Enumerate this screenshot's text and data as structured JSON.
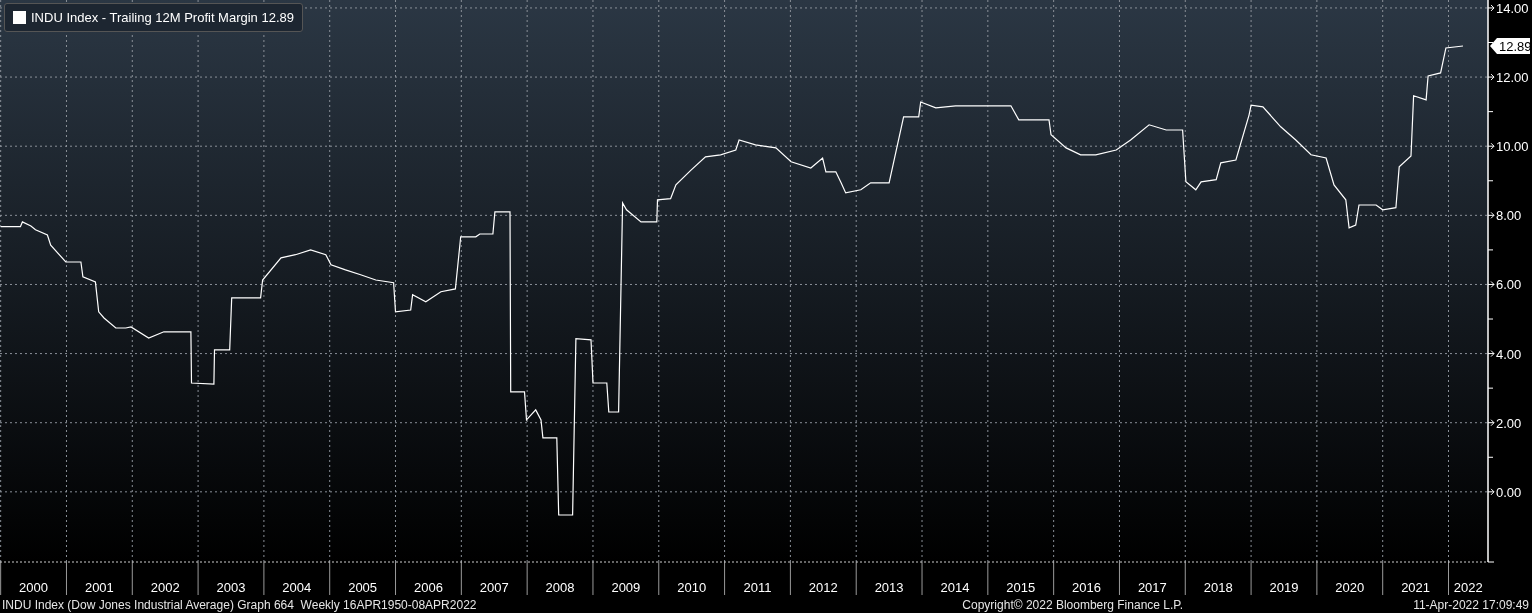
{
  "chart": {
    "legend": {
      "value": "12.89"
    },
    "last_value_tag": "12.89",
    "chart_data": {
      "type": "line",
      "grid": true,
      "xlim": [
        1999.99,
        2022.6
      ],
      "ylim": [
        -2.03,
        14.23
      ],
      "yticks": [
        {
          "value": 0,
          "label": "0.00"
        },
        {
          "value": 2,
          "label": "2.00"
        },
        {
          "value": 4,
          "label": "4.00"
        },
        {
          "value": 6,
          "label": "6.00"
        },
        {
          "value": 8,
          "label": "8.00"
        },
        {
          "value": 10,
          "label": "10.00"
        },
        {
          "value": 12,
          "label": "12.00"
        },
        {
          "value": 14,
          "label": "14.00"
        }
      ],
      "xticks": [
        {
          "value": 2000.5,
          "label": "2000"
        },
        {
          "value": 2001.5,
          "label": "2001"
        },
        {
          "value": 2002.5,
          "label": "2002"
        },
        {
          "value": 2003.5,
          "label": "2003"
        },
        {
          "value": 2004.5,
          "label": "2004"
        },
        {
          "value": 2005.5,
          "label": "2005"
        },
        {
          "value": 2006.5,
          "label": "2006"
        },
        {
          "value": 2007.5,
          "label": "2007"
        },
        {
          "value": 2008.5,
          "label": "2008"
        },
        {
          "value": 2009.5,
          "label": "2009"
        },
        {
          "value": 2010.5,
          "label": "2010"
        },
        {
          "value": 2011.5,
          "label": "2011"
        },
        {
          "value": 2012.5,
          "label": "2012"
        },
        {
          "value": 2013.5,
          "label": "2013"
        },
        {
          "value": 2014.5,
          "label": "2014"
        },
        {
          "value": 2015.5,
          "label": "2015"
        },
        {
          "value": 2016.5,
          "label": "2016"
        },
        {
          "value": 2017.5,
          "label": "2017"
        },
        {
          "value": 2018.5,
          "label": "2018"
        },
        {
          "value": 2019.5,
          "label": "2019"
        },
        {
          "value": 2020.5,
          "label": "2020"
        },
        {
          "value": 2021.5,
          "label": "2021"
        },
        {
          "value": 2022.3,
          "label": "2022"
        }
      ],
      "x": [
        2000.0,
        2000.3,
        2000.33,
        2000.46,
        2000.53,
        2000.71,
        2000.76,
        2000.99,
        2001.22,
        2001.25,
        2001.44,
        2001.49,
        2001.57,
        2001.75,
        2001.9,
        2001.98,
        2002.25,
        2002.48,
        2002.89,
        2002.9,
        2003.24,
        2003.25,
        2003.48,
        2003.51,
        2003.95,
        2003.98,
        2004.26,
        2004.48,
        2004.71,
        2004.94,
        2005.02,
        2005.24,
        2005.47,
        2005.7,
        2005.97,
        2006.0,
        2006.23,
        2006.26,
        2006.46,
        2006.69,
        2006.91,
        2006.99,
        2007.22,
        2007.28,
        2007.48,
        2007.51,
        2007.74,
        2007.75,
        2007.96,
        2007.99,
        2008.13,
        2008.21,
        2008.24,
        2008.45,
        2008.48,
        2008.69,
        2008.74,
        2008.97,
        2009.0,
        2009.21,
        2009.24,
        2009.39,
        2009.45,
        2009.51,
        2009.73,
        2009.97,
        2009.98,
        2010.18,
        2010.26,
        2010.49,
        2010.71,
        2010.94,
        2011.17,
        2011.22,
        2011.47,
        2011.78,
        2012.01,
        2012.31,
        2012.49,
        2012.54,
        2012.69,
        2012.77,
        2012.84,
        2013.07,
        2013.22,
        2013.5,
        2013.72,
        2013.95,
        2013.98,
        2014.21,
        2014.51,
        2014.97,
        2015.35,
        2015.47,
        2015.93,
        2015.96,
        2016.19,
        2016.41,
        2016.64,
        2016.95,
        2017.17,
        2017.45,
        2017.71,
        2017.96,
        2018.01,
        2018.16,
        2018.24,
        2018.47,
        2018.54,
        2018.77,
        2018.97,
        2019.0,
        2019.18,
        2019.45,
        2019.68,
        2019.91,
        2020.14,
        2020.26,
        2020.44,
        2020.49,
        2020.59,
        2020.64,
        2020.9,
        2021.0,
        2021.2,
        2021.25,
        2021.43,
        2021.47,
        2021.66,
        2021.69,
        2021.88,
        2021.96,
        2022.22
      ],
      "series": [
        {
          "name": "INDU Index - Trailing 12M Profit Margin",
          "color": "#ffffff",
          "values": [
            7.67,
            7.67,
            7.81,
            7.69,
            7.58,
            7.43,
            7.14,
            6.65,
            6.65,
            6.22,
            6.07,
            5.21,
            5.03,
            4.74,
            4.74,
            4.77,
            4.45,
            4.63,
            4.63,
            3.15,
            3.12,
            4.11,
            4.11,
            5.61,
            5.61,
            6.13,
            6.77,
            6.86,
            7.0,
            6.86,
            6.57,
            6.42,
            6.28,
            6.13,
            6.05,
            5.21,
            5.26,
            5.7,
            5.5,
            5.79,
            5.87,
            7.38,
            7.38,
            7.46,
            7.46,
            8.1,
            8.1,
            2.89,
            2.89,
            2.08,
            2.37,
            2.08,
            1.56,
            1.56,
            -0.67,
            -0.67,
            4.43,
            4.4,
            3.15,
            3.15,
            2.31,
            2.31,
            8.36,
            8.16,
            7.81,
            7.81,
            8.45,
            8.48,
            8.88,
            9.31,
            9.69,
            9.75,
            9.89,
            10.18,
            10.04,
            9.95,
            9.55,
            9.37,
            9.66,
            9.26,
            9.26,
            8.94,
            8.65,
            8.74,
            8.94,
            8.94,
            10.85,
            10.85,
            11.28,
            11.11,
            11.17,
            11.17,
            11.17,
            10.76,
            10.76,
            10.33,
            9.95,
            9.75,
            9.75,
            9.89,
            10.18,
            10.62,
            10.47,
            10.47,
            8.97,
            8.74,
            8.97,
            9.03,
            9.52,
            9.6,
            10.91,
            11.19,
            11.14,
            10.56,
            10.18,
            9.75,
            9.66,
            8.88,
            8.45,
            7.64,
            7.72,
            8.3,
            8.3,
            8.16,
            8.22,
            9.4,
            9.72,
            11.46,
            11.34,
            12.03,
            12.12,
            12.84,
            12.9
          ]
        }
      ]
    }
  },
  "footer": {
    "description": "INDU Index (Dow Jones Industrial Average) Graph 664  Weekly 16APR1950-08APR2022",
    "copyright": "Copyright© 2022 Bloomberg Finance L.P.",
    "timestamp": "11-Apr-2022 17:09:49"
  }
}
